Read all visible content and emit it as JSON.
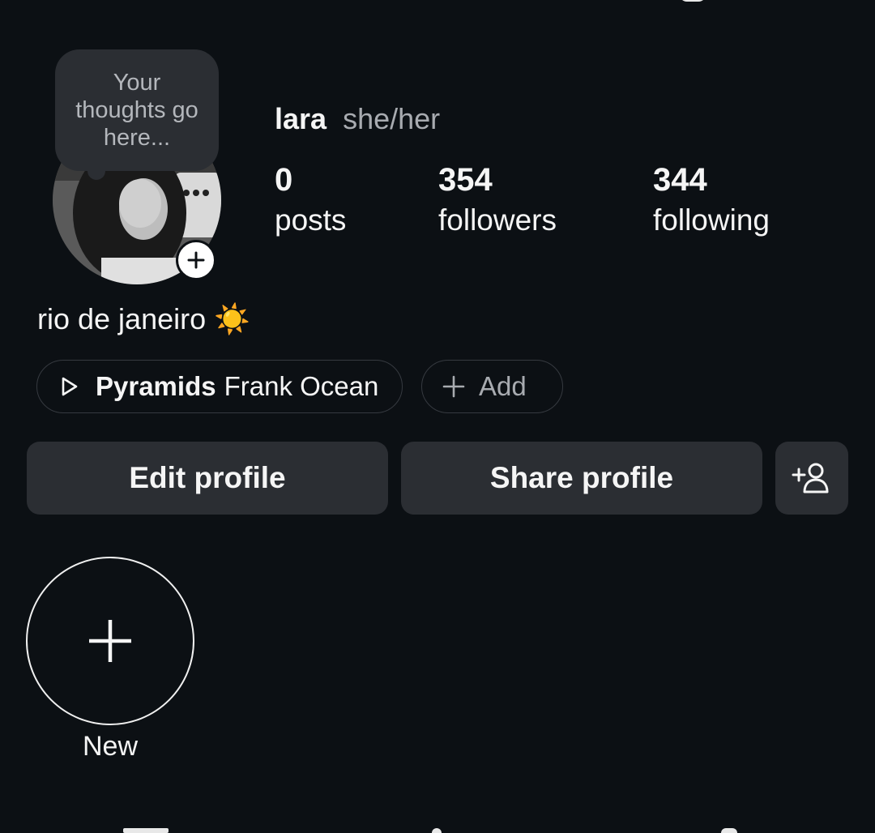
{
  "profile": {
    "note": "Your thoughts go here...",
    "username": "lara",
    "pronouns": "she/her",
    "stats": {
      "posts": {
        "value": "0",
        "label": "posts"
      },
      "followers": {
        "value": "354",
        "label": "followers"
      },
      "following": {
        "value": "344",
        "label": "following"
      }
    },
    "bio": "rio de janeiro ☀️"
  },
  "music": {
    "song": "Pyramids",
    "artist": "Frank Ocean",
    "icon": "play-icon"
  },
  "add_pill": {
    "label": "Add",
    "icon": "plus-icon"
  },
  "actions": {
    "edit_label": "Edit profile",
    "share_label": "Share profile",
    "discover_icon": "add-person-icon"
  },
  "highlights": {
    "new_label": "New",
    "icon": "plus-icon"
  },
  "colors": {
    "background": "#0c1014",
    "button": "#2b2e33",
    "secondary_text": "#a8abb0"
  }
}
